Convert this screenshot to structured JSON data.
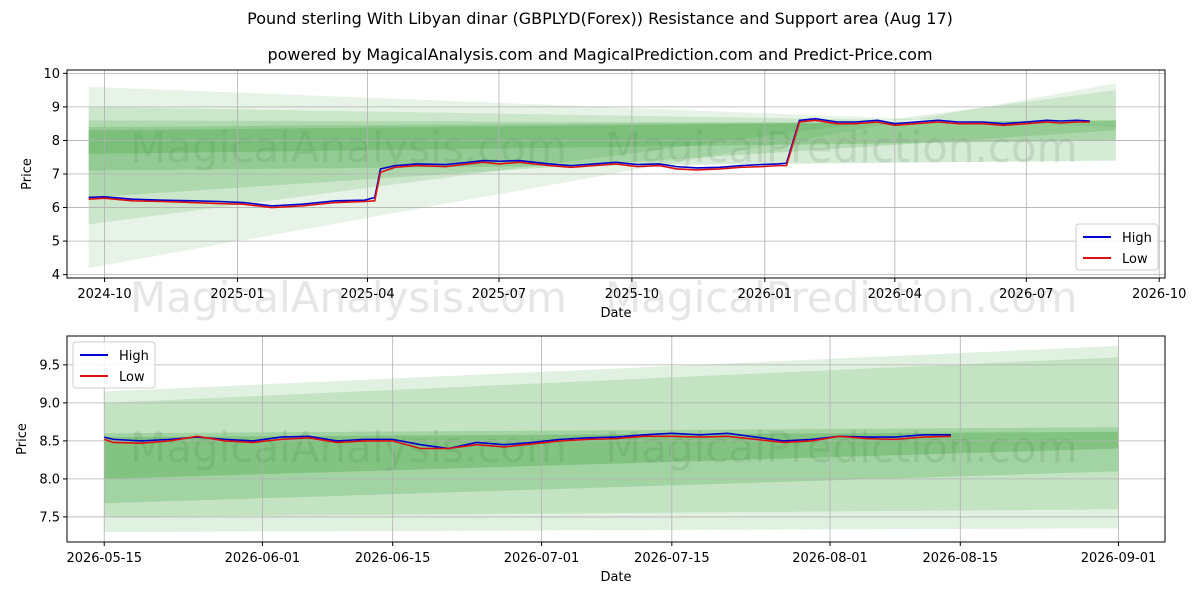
{
  "title": "Pound sterling With Libyan dinar (GBPLYD(Forex)) Resistance and Support area (Aug 17)",
  "subtitle": "powered by MagicalAnalysis.com and MagicalPrediction.com and Predict-Price.com",
  "watermarks": [
    "MagicalAnalysis.com",
    "MagicalPrediction.com"
  ],
  "colors": {
    "high": "#0000cc",
    "low": "#dd1111",
    "band": "#2e9a2e",
    "grid": "#b0b0b0"
  },
  "chart_data": [
    {
      "type": "line",
      "xlabel": "Date",
      "ylabel": "Price",
      "xlim": [
        "2024-09-05",
        "2026-10-05"
      ],
      "ylim": [
        3.9,
        10.1
      ],
      "xticks": [
        "2024-10",
        "2025-01",
        "2025-04",
        "2025-07",
        "2025-10",
        "2026-01",
        "2026-04",
        "2026-07",
        "2026-10"
      ],
      "yticks": [
        "4",
        "5",
        "6",
        "7",
        "8",
        "9",
        "10"
      ],
      "grid": true,
      "legend": {
        "position": "lower-right",
        "entries": [
          "High",
          "Low"
        ]
      },
      "series": [
        {
          "name": "High",
          "x": [
            "2024-09-20",
            "2024-10-01",
            "2024-10-20",
            "2024-11-10",
            "2024-12-01",
            "2024-12-20",
            "2025-01-05",
            "2025-01-25",
            "2025-02-15",
            "2025-03-10",
            "2025-03-30",
            "2025-04-06",
            "2025-04-10",
            "2025-04-20",
            "2025-05-05",
            "2025-05-25",
            "2025-06-10",
            "2025-06-20",
            "2025-07-01",
            "2025-07-15",
            "2025-08-05",
            "2025-08-20",
            "2025-09-05",
            "2025-09-20",
            "2025-10-05",
            "2025-10-20",
            "2025-11-01",
            "2025-11-15",
            "2025-12-01",
            "2025-12-15",
            "2025-12-30",
            "2026-01-10",
            "2026-01-16",
            "2026-01-25",
            "2026-02-05",
            "2026-02-20",
            "2026-03-05",
            "2026-03-20",
            "2026-04-01",
            "2026-04-15",
            "2026-05-01",
            "2026-05-15",
            "2026-06-01",
            "2026-06-15",
            "2026-07-01",
            "2026-07-15",
            "2026-07-25",
            "2026-08-05",
            "2026-08-14"
          ],
          "values": [
            6.3,
            6.32,
            6.25,
            6.22,
            6.2,
            6.18,
            6.15,
            6.05,
            6.1,
            6.2,
            6.22,
            6.3,
            7.15,
            7.25,
            7.3,
            7.28,
            7.35,
            7.4,
            7.38,
            7.4,
            7.3,
            7.25,
            7.3,
            7.35,
            7.28,
            7.3,
            7.22,
            7.18,
            7.2,
            7.25,
            7.28,
            7.3,
            7.32,
            8.6,
            8.65,
            8.55,
            8.55,
            8.6,
            8.5,
            8.55,
            8.6,
            8.55,
            8.55,
            8.5,
            8.55,
            8.6,
            8.58,
            8.6,
            8.58
          ]
        },
        {
          "name": "Low",
          "x": [
            "2024-09-20",
            "2024-10-01",
            "2024-10-20",
            "2024-11-10",
            "2024-12-01",
            "2024-12-20",
            "2025-01-05",
            "2025-01-25",
            "2025-02-15",
            "2025-03-10",
            "2025-03-30",
            "2025-04-06",
            "2025-04-10",
            "2025-04-20",
            "2025-05-05",
            "2025-05-25",
            "2025-06-10",
            "2025-06-20",
            "2025-07-01",
            "2025-07-15",
            "2025-08-05",
            "2025-08-20",
            "2025-09-05",
            "2025-09-20",
            "2025-10-05",
            "2025-10-20",
            "2025-11-01",
            "2025-11-15",
            "2025-12-01",
            "2025-12-15",
            "2025-12-30",
            "2026-01-10",
            "2026-01-16",
            "2026-01-25",
            "2026-02-05",
            "2026-02-20",
            "2026-03-05",
            "2026-03-20",
            "2026-04-01",
            "2026-04-15",
            "2026-05-01",
            "2026-05-15",
            "2026-06-01",
            "2026-06-15",
            "2026-07-01",
            "2026-07-15",
            "2026-07-25",
            "2026-08-05",
            "2026-08-14"
          ],
          "values": [
            6.25,
            6.28,
            6.2,
            6.18,
            6.15,
            6.12,
            6.1,
            6.0,
            6.05,
            6.15,
            6.18,
            6.2,
            7.05,
            7.2,
            7.25,
            7.22,
            7.3,
            7.35,
            7.3,
            7.35,
            7.25,
            7.2,
            7.25,
            7.3,
            7.22,
            7.25,
            7.15,
            7.12,
            7.15,
            7.2,
            7.22,
            7.25,
            7.25,
            8.55,
            8.6,
            8.5,
            8.5,
            8.55,
            8.45,
            8.5,
            8.55,
            8.5,
            8.5,
            8.45,
            8.5,
            8.55,
            8.52,
            8.55,
            8.55
          ]
        }
      ],
      "bands": [
        {
          "x": [
            "2024-09-20",
            "2026-09-01"
          ],
          "top": [
            9.6,
            8.4
          ],
          "bottom": [
            4.2,
            9.7
          ],
          "opacity": 0.12
        },
        {
          "x": [
            "2024-09-20",
            "2026-09-01"
          ],
          "top": [
            9.0,
            8.5
          ],
          "bottom": [
            5.5,
            9.5
          ],
          "opacity": 0.14
        },
        {
          "x": [
            "2024-09-20",
            "2026-09-01"
          ],
          "top": [
            8.6,
            8.5
          ],
          "bottom": [
            6.3,
            8.3
          ],
          "opacity": 0.18
        },
        {
          "x": [
            "2024-09-20",
            "2026-09-01"
          ],
          "top": [
            8.4,
            8.6
          ],
          "bottom": [
            7.1,
            7.4
          ],
          "opacity": 0.2
        },
        {
          "x": [
            "2024-09-20",
            "2026-09-01"
          ],
          "top": [
            8.3,
            8.6
          ],
          "bottom": [
            7.6,
            8.0
          ],
          "opacity": 0.25
        }
      ]
    },
    {
      "type": "line",
      "xlabel": "Date",
      "ylabel": "Price",
      "xlim": [
        "2026-05-11",
        "2026-09-06"
      ],
      "ylim": [
        7.17,
        9.88
      ],
      "xticks": [
        "2026-05-15",
        "2026-06-01",
        "2026-06-15",
        "2026-07-01",
        "2026-07-15",
        "2026-08-01",
        "2026-08-15",
        "2026-09-01"
      ],
      "yticks": [
        "7.5",
        "8.0",
        "8.5",
        "9.0",
        "9.5"
      ],
      "grid": true,
      "legend": {
        "position": "upper-left",
        "entries": [
          "High",
          "Low"
        ]
      },
      "series": [
        {
          "name": "High",
          "x": [
            "2026-05-15",
            "2026-05-16",
            "2026-05-19",
            "2026-05-22",
            "2026-05-25",
            "2026-05-28",
            "2026-05-31",
            "2026-06-03",
            "2026-06-06",
            "2026-06-09",
            "2026-06-12",
            "2026-06-15",
            "2026-06-18",
            "2026-06-21",
            "2026-06-24",
            "2026-06-27",
            "2026-06-30",
            "2026-07-03",
            "2026-07-06",
            "2026-07-09",
            "2026-07-12",
            "2026-07-15",
            "2026-07-18",
            "2026-07-21",
            "2026-07-24",
            "2026-07-27",
            "2026-07-30",
            "2026-08-02",
            "2026-08-05",
            "2026-08-08",
            "2026-08-11",
            "2026-08-14"
          ],
          "values": [
            8.55,
            8.52,
            8.5,
            8.52,
            8.55,
            8.52,
            8.5,
            8.55,
            8.56,
            8.5,
            8.52,
            8.52,
            8.45,
            8.4,
            8.48,
            8.45,
            8.48,
            8.52,
            8.54,
            8.55,
            8.58,
            8.6,
            8.58,
            8.6,
            8.55,
            8.5,
            8.52,
            8.56,
            8.55,
            8.55,
            8.58,
            8.58
          ]
        },
        {
          "name": "Low",
          "x": [
            "2026-05-15",
            "2026-05-16",
            "2026-05-19",
            "2026-05-22",
            "2026-05-25",
            "2026-05-28",
            "2026-05-31",
            "2026-06-03",
            "2026-06-06",
            "2026-06-09",
            "2026-06-12",
            "2026-06-15",
            "2026-06-18",
            "2026-06-21",
            "2026-06-24",
            "2026-06-27",
            "2026-06-30",
            "2026-07-03",
            "2026-07-06",
            "2026-07-09",
            "2026-07-12",
            "2026-07-15",
            "2026-07-18",
            "2026-07-21",
            "2026-07-24",
            "2026-07-27",
            "2026-07-30",
            "2026-08-02",
            "2026-08-05",
            "2026-08-08",
            "2026-08-11",
            "2026-08-14"
          ],
          "values": [
            8.52,
            8.48,
            8.47,
            8.5,
            8.56,
            8.5,
            8.48,
            8.52,
            8.54,
            8.48,
            8.5,
            8.5,
            8.4,
            8.4,
            8.45,
            8.42,
            8.46,
            8.5,
            8.52,
            8.53,
            8.56,
            8.56,
            8.55,
            8.56,
            8.52,
            8.48,
            8.5,
            8.56,
            8.53,
            8.52,
            8.55,
            8.56
          ]
        }
      ],
      "bands": [
        {
          "x": [
            "2026-05-15",
            "2026-09-01"
          ],
          "top": [
            9.15,
            9.75
          ],
          "bottom": [
            7.3,
            7.35
          ],
          "opacity": 0.14
        },
        {
          "x": [
            "2026-05-15",
            "2026-09-01"
          ],
          "top": [
            9.0,
            9.6
          ],
          "bottom": [
            7.5,
            7.6
          ],
          "opacity": 0.16
        },
        {
          "x": [
            "2026-05-15",
            "2026-09-01"
          ],
          "top": [
            8.6,
            8.68
          ],
          "bottom": [
            7.68,
            8.1
          ],
          "opacity": 0.22
        },
        {
          "x": [
            "2026-05-15",
            "2026-09-01"
          ],
          "top": [
            8.55,
            8.62
          ],
          "bottom": [
            8.0,
            8.4
          ],
          "opacity": 0.28
        }
      ]
    }
  ]
}
